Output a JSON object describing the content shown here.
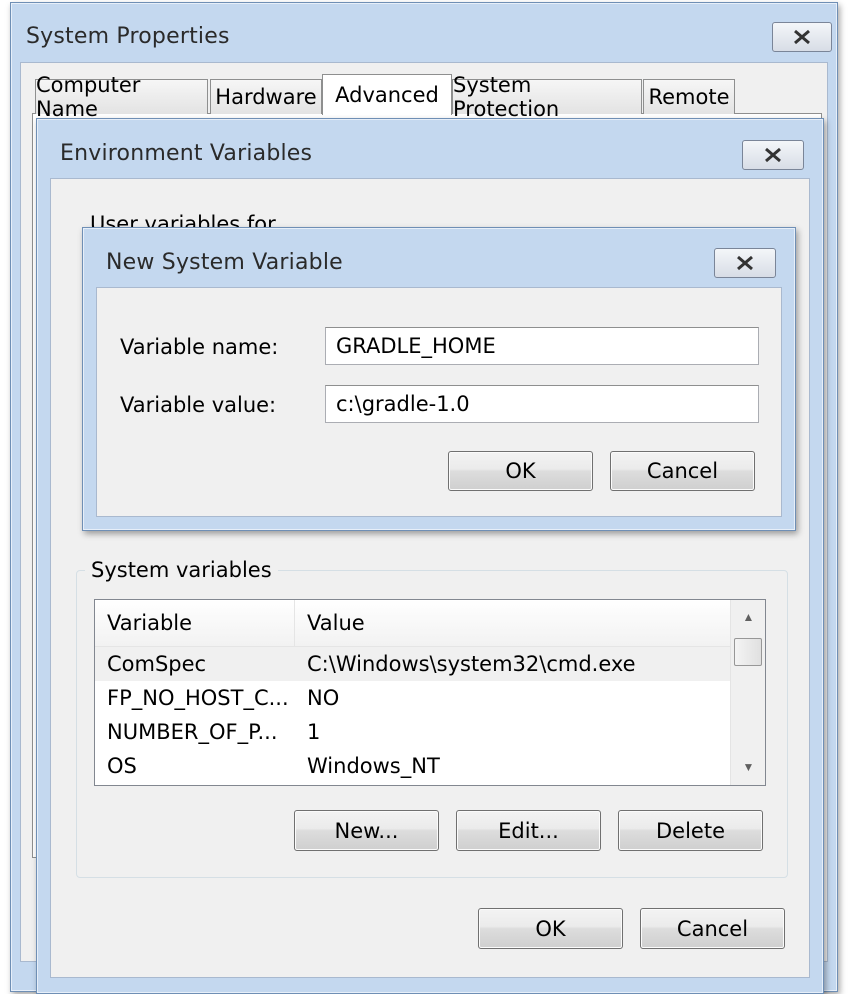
{
  "system_properties": {
    "title": "System Properties",
    "tabs": [
      {
        "label": "Computer Name"
      },
      {
        "label": "Hardware"
      },
      {
        "label": "Advanced"
      },
      {
        "label": "System Protection"
      },
      {
        "label": "Remote"
      }
    ],
    "active_tab": "Advanced"
  },
  "environment_variables": {
    "title": "Environment Variables",
    "user_section_label": "User variables for ...",
    "system_section_label": "System variables",
    "columns": [
      "Variable",
      "Value"
    ],
    "rows": [
      {
        "variable": "ComSpec",
        "value": "C:\\Windows\\system32\\cmd.exe"
      },
      {
        "variable": "FP_NO_HOST_C...",
        "value": "NO"
      },
      {
        "variable": "NUMBER_OF_P...",
        "value": "1"
      },
      {
        "variable": "OS",
        "value": "Windows_NT"
      }
    ],
    "new_label": "New...",
    "edit_label": "Edit...",
    "delete_label": "Delete",
    "ok_label": "OK",
    "cancel_label": "Cancel"
  },
  "new_system_variable": {
    "title": "New System Variable",
    "name_label": "Variable name:",
    "name_value": "GRADLE_HOME",
    "value_label": "Variable value:",
    "value_value": "c:\\gradle-1.0",
    "ok_label": "OK",
    "cancel_label": "Cancel"
  },
  "colors": {
    "frame": "#c4d8ef",
    "frame_border": "#6f8fb5",
    "client": "#f0f0f0"
  }
}
